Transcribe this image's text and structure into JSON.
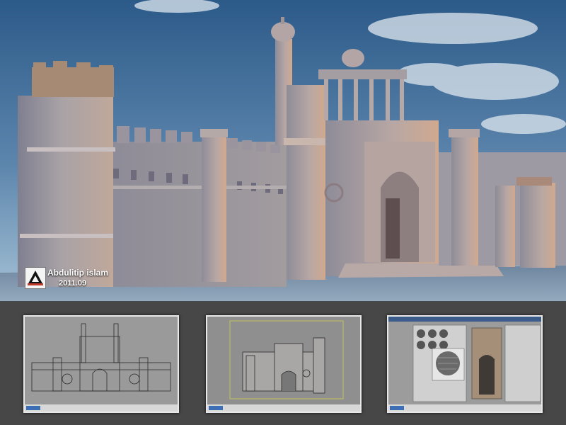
{
  "credit": {
    "author": "Abdulitip islam",
    "date": "2011.09",
    "logo_icon": "triangle-a-logo-icon"
  },
  "thumbnails": [
    {
      "name": "front-wireframe-viewport",
      "description_icon": "orthographic-wireframe-icon"
    },
    {
      "name": "perspective-viewport",
      "description_icon": "perspective-wireframe-icon"
    },
    {
      "name": "material-editor-viewport",
      "description_icon": "material-editor-icon"
    }
  ],
  "colors": {
    "sky_top": "#2f5e8e",
    "sky_bottom": "#8fb3cc",
    "stone": "#a6a0a6",
    "ground": "#7c8fa6",
    "strip_bg": "#474747"
  }
}
